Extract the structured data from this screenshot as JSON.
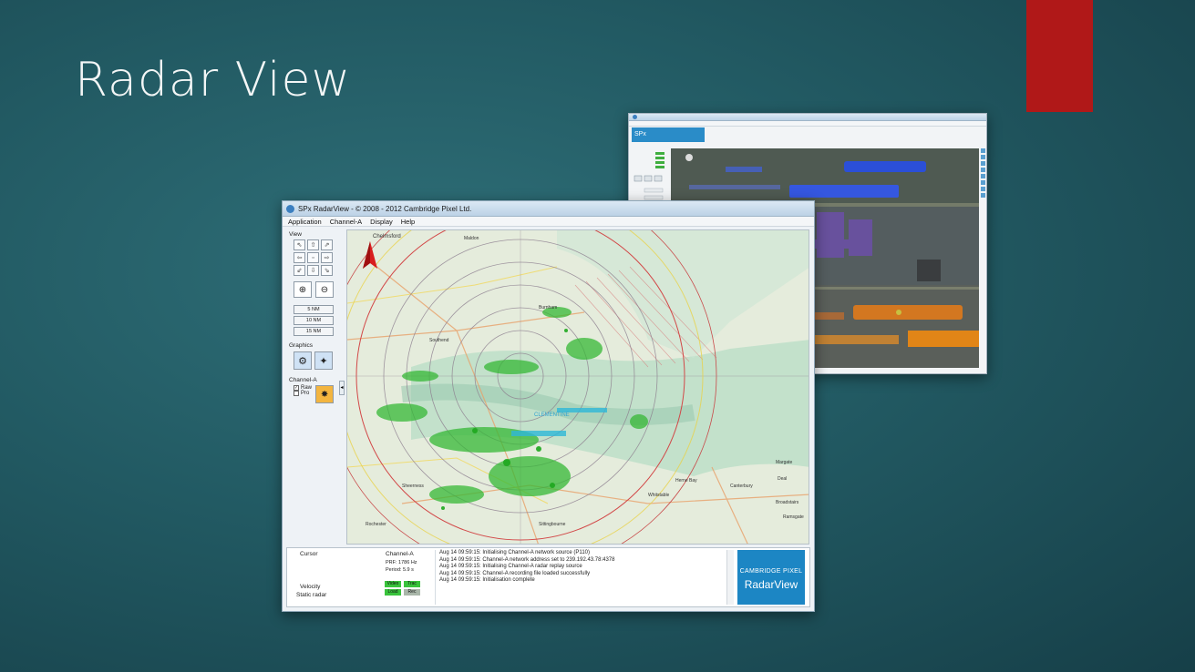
{
  "slide": {
    "title": "Radar View",
    "accent_color": "#b01818"
  },
  "main_window": {
    "title": "SPx RadarView - © 2008 - 2012 Cambridge Pixel Ltd.",
    "menu": [
      "Application",
      "Channel-A",
      "Display",
      "Help"
    ],
    "left_panel": {
      "view_label": "View",
      "arrow_icons": [
        "arrow-up-left-icon",
        "arrow-up-icon",
        "arrow-up-right-icon",
        "arrow-left-icon",
        "center-icon",
        "arrow-right-icon",
        "arrow-down-left-icon",
        "arrow-down-icon",
        "arrow-down-right-icon"
      ],
      "zoom_in_icon": "zoom-in-icon",
      "zoom_out_icon": "zoom-out-icon",
      "range_buttons": [
        "5 NM",
        "10 NM",
        "15 NM"
      ],
      "graphics_label": "Graphics",
      "channel_label": "Channel-A",
      "raw_label": "Raw",
      "pro_label": "Pro"
    },
    "map": {
      "north_label": "Chelmsford",
      "place_labels": [
        "Maldon",
        "Burnham",
        "Southend",
        "CLEMENTINE",
        "Deal",
        "Canterbury",
        "Margate",
        "Herne Bay",
        "Whitstable",
        "Ramsgate",
        "Broadstairs",
        "Sittingbourne",
        "Sheerness",
        "Rochester"
      ],
      "compass_color": "#d81e1e"
    },
    "status": {
      "cursor_label": "Cursor",
      "channel_label": "Channel-A",
      "prf": "PRF: 1786 Hz",
      "period": "Period: 5.9 s",
      "velocity_label": "Velocity",
      "static_label": "Static radar",
      "badges": [
        "Video",
        "Trac",
        "Load",
        "Rec"
      ]
    },
    "log_lines": [
      "Aug 14 09:59:15: Initialising Channel-A network source (P110)",
      "Aug 14 09:59:15: Channel-A network address set to 239.192.43.78:4378",
      "Aug 14 09:59:15: Initialising Channel-A radar replay source",
      "Aug 14 09:59:15: Channel-A recording file loaded successfully",
      "Aug 14 09:59:15: Initialisation complete"
    ],
    "logo": {
      "line1": "CAMBRIDGE PIXEL",
      "line2": "RadarView"
    }
  },
  "sub_window": {
    "logo_text": "SPx"
  }
}
